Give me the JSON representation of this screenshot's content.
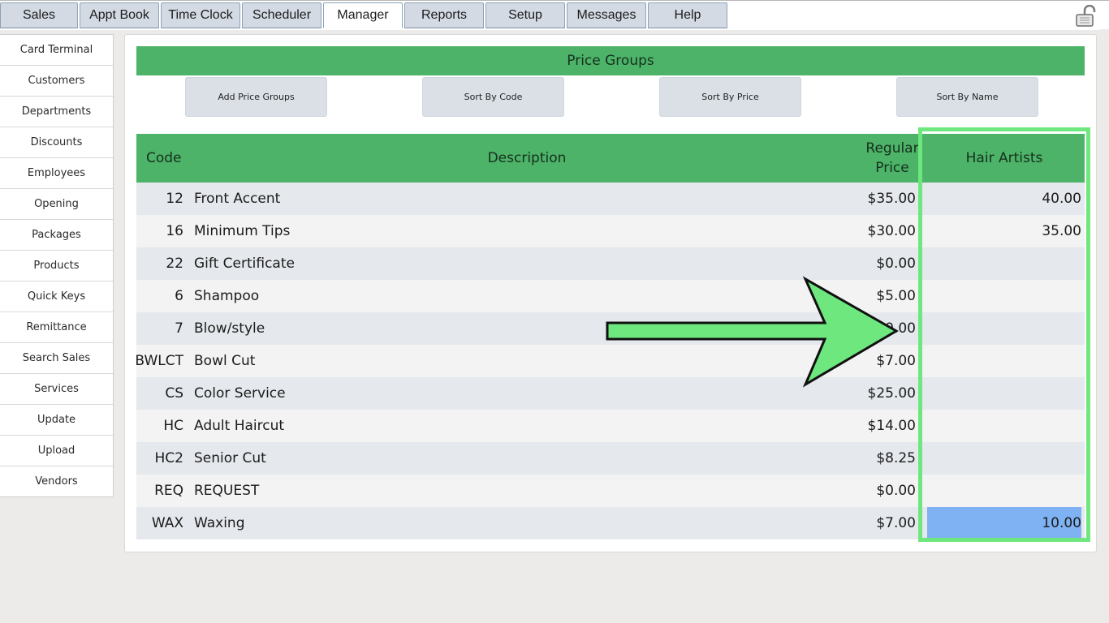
{
  "nav": {
    "tabs": [
      "Sales",
      "Appt Book",
      "Time Clock",
      "Scheduler",
      "Manager",
      "Reports",
      "Setup",
      "Messages",
      "Help"
    ],
    "active_tab": "Manager"
  },
  "lock_icon": "padlock-open-icon",
  "sidebar": {
    "items": [
      "Card Terminal",
      "Customers",
      "Departments",
      "Discounts",
      "Employees",
      "Opening",
      "Packages",
      "Products",
      "Quick Keys",
      "Remittance",
      "Search Sales",
      "Services",
      "Update",
      "Upload",
      "Vendors"
    ]
  },
  "page": {
    "title": "Price Groups",
    "buttons": {
      "add": "Add Price Groups",
      "sort_code": "Sort By Code",
      "sort_price": "Sort By Price",
      "sort_name": "Sort By Name"
    }
  },
  "table": {
    "headers": {
      "code": "Code",
      "description": "Description",
      "regular_price_1": "Regular",
      "regular_price_2": "Price",
      "group": "Hair Artists"
    },
    "rows": [
      {
        "code": "12",
        "description": "Front Accent",
        "price": "$35.00",
        "group_price": "40.00"
      },
      {
        "code": "16",
        "description": "Minimum Tips",
        "price": "$30.00",
        "group_price": "35.00"
      },
      {
        "code": "22",
        "description": "Gift Certificate",
        "price": "$0.00",
        "group_price": ""
      },
      {
        "code": "6",
        "description": "Shampoo",
        "price": "$5.00",
        "group_price": ""
      },
      {
        "code": "7",
        "description": "Blow/style",
        "price": "$0.00",
        "group_price": ""
      },
      {
        "code": "BWLCT",
        "description": "Bowl Cut",
        "price": "$7.00",
        "group_price": ""
      },
      {
        "code": "CS",
        "description": "Color Service",
        "price": "$25.00",
        "group_price": ""
      },
      {
        "code": "HC",
        "description": "Adult Haircut",
        "price": "$14.00",
        "group_price": ""
      },
      {
        "code": "HC2",
        "description": "Senior Cut",
        "price": "$8.25",
        "group_price": ""
      },
      {
        "code": "REQ",
        "description": "REQUEST",
        "price": "$0.00",
        "group_price": ""
      },
      {
        "code": "WAX",
        "description": "Waxing",
        "price": "$7.00",
        "group_price": "10.00"
      }
    ],
    "selected_row": 10
  },
  "annotation": {
    "arrow_icon": "pointer-arrow-icon",
    "highlight_color": "#6ee77f"
  },
  "colors": {
    "header_green": "#4cb368",
    "selected_cell": "#7eb2f3",
    "tab_bg": "#d3dae3"
  }
}
